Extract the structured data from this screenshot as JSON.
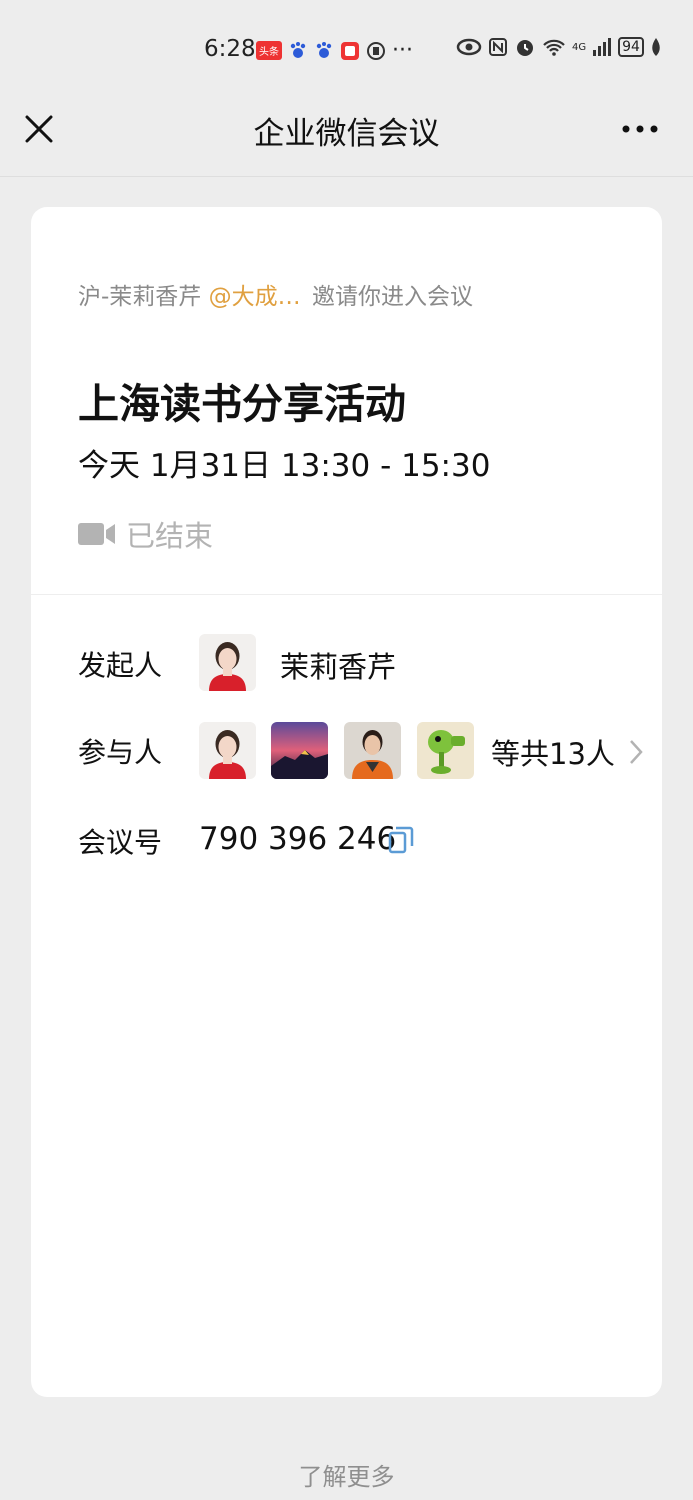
{
  "status_bar": {
    "time": "6:28",
    "notification_badge": "头条",
    "battery": "94",
    "network": "4G"
  },
  "nav": {
    "title": "企业微信会议"
  },
  "invite": {
    "inviter": "沪-茉莉香芹",
    "mention": "@大成…",
    "message": "邀请你进入会议"
  },
  "meeting": {
    "title": "上海读书分享活动",
    "time": "今天 1月31日 13:30 - 15:30",
    "status": "已结束"
  },
  "host": {
    "label": "发起人",
    "name": "茉莉香芹"
  },
  "participants": {
    "label": "参与人",
    "total": "等共13人"
  },
  "meeting_number": {
    "label": "会议号",
    "value": "790 396 246"
  },
  "footer": {
    "learn_more": "了解更多"
  },
  "colors": {
    "background": "#ededed",
    "card": "#ffffff",
    "mention": "#e0a040",
    "copy_icon": "#5b9bd5",
    "muted": "#b3b3b3"
  }
}
